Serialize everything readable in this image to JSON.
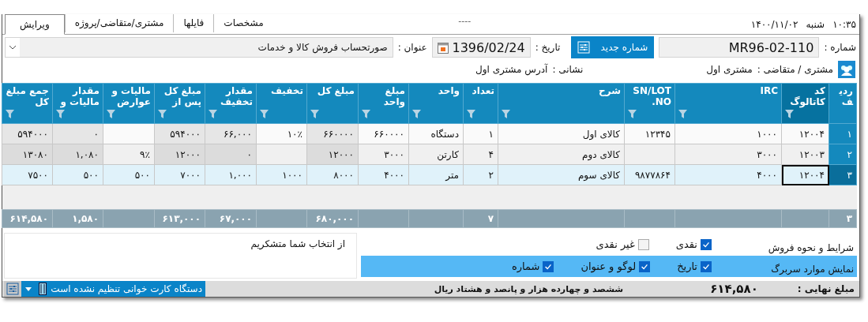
{
  "clock": {
    "time": "۱۰:۳۵",
    "day": "شنبه",
    "date": "۱۴۰۰/۱۱/۰۲"
  },
  "status_placeholder": "----",
  "tabs": [
    {
      "label": "مشخصات",
      "selected": false
    },
    {
      "label": "فایلها",
      "selected": false
    },
    {
      "label": "مشتری/متقاضی/پروژه",
      "selected": false
    },
    {
      "label": "ویرایش",
      "selected": true
    }
  ],
  "header": {
    "number_label": "شماره :",
    "number": "MR96-02-110",
    "new_number_button": "شماره جدید",
    "date_label": "تاریخ :",
    "date": "1396/02/24",
    "title_label": "عنوان :",
    "title": "صورتحساب فروش کالا و خدمات",
    "customer_label": "مشتری / متقاضی :",
    "customer": "مشتری اول",
    "address_label": "نشانی :",
    "address": "آدرس مشتری اول"
  },
  "table": {
    "columns": [
      {
        "label": "ردیف",
        "total": "۳"
      },
      {
        "label": "کد کاتالوگ",
        "readonly": false
      },
      {
        "label": "IRC",
        "readonly": false
      },
      {
        "label": "SN/LOT NO.",
        "readonly": false
      },
      {
        "label": "شرح",
        "readonly": false
      },
      {
        "label": "تعداد",
        "readonly": false,
        "total": "۷"
      },
      {
        "label": "واحد",
        "readonly": false
      },
      {
        "label": "مبلغ واحد",
        "readonly": false
      },
      {
        "label": "مبلغ کل",
        "readonly": true,
        "total": "۶۸۰,۰۰۰"
      },
      {
        "label": "تخفیف",
        "readonly": false
      },
      {
        "label": "مقدار تخفیف",
        "readonly": true,
        "total": "۶۷,۰۰۰"
      },
      {
        "label": "مبلغ کل پس از",
        "readonly": true,
        "total": "۶۱۳,۰۰۰"
      },
      {
        "label": "مالیات و عوارض",
        "readonly": false
      },
      {
        "label": "مقدار مالیات و",
        "readonly": true,
        "total": "۱,۵۸۰"
      },
      {
        "label": "جمع مبلغ کل",
        "readonly": true,
        "total": "۶۱۴,۵۸۰"
      }
    ],
    "rows": [
      {
        "selected": false,
        "cells": [
          "۱",
          "۱۲۰۰۴",
          "۱۰۰۰",
          "۱۲۳۴۵",
          "کالای اول",
          "۱",
          "دستگاه",
          "۶۶۰۰۰۰",
          "۶۶۰۰۰۰",
          "۱۰٪",
          "۶۶,۰۰۰",
          "۵۹۴۰۰۰",
          null,
          "۰",
          "۵۹۴۰۰۰"
        ]
      },
      {
        "selected": false,
        "cells": [
          "۲",
          "۱۲۰۰۳",
          "۳۰۰۰",
          null,
          "کالای دوم",
          "۴",
          "کارتن",
          "۳۰۰۰",
          "۱۲۰۰۰",
          null,
          "۰",
          "۱۲۰۰۰",
          "۹٪",
          "۱,۰۸۰",
          "۱۳۰۸۰"
        ]
      },
      {
        "selected": true,
        "cells": [
          "۳",
          "۱۲۰۰۴",
          "۴۰۰۰",
          "۹۸۷۷۸۶۴",
          "کالای سوم",
          "۲",
          "متر",
          "۴۰۰۰",
          "۸۰۰۰",
          "۱۰۰۰",
          "۱,۰۰۰",
          "۷۰۰۰",
          "۵۰۰",
          "۵۰۰",
          "۷۵۰۰"
        ]
      }
    ]
  },
  "options": [
    {
      "label": "شرایط و نحوه فروش",
      "highlighted": false,
      "checkboxes": [
        {
          "label": "نقدی",
          "checked": true
        },
        {
          "label": "غیر نقدی",
          "checked": false
        }
      ]
    },
    {
      "label": "نمایش موارد سربرگ",
      "highlighted": true,
      "checkboxes": [
        {
          "label": "تاریخ",
          "checked": true
        },
        {
          "label": "لوگو و عنوان",
          "checked": true
        },
        {
          "label": "شماره",
          "checked": true
        }
      ]
    }
  ],
  "note": "از انتخاب شما متشکریم",
  "footer": {
    "final_label": "مبلغ نهایی :",
    "final_amount": "۶۱۴,۵۸۰",
    "amount_words": "ششصد و چهارده هزار و پانصد و هشتاد ریال",
    "card_reader": "دستگاه کارت خوانی تنظیم نشده است"
  }
}
